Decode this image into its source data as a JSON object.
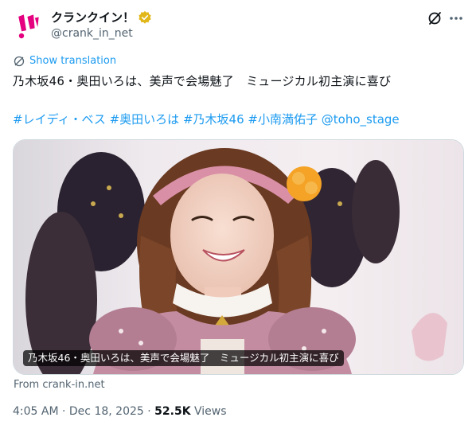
{
  "author": {
    "name": "クランクイン！",
    "handle": "@crank_in_net",
    "verified": true,
    "brand_color": "#e4007f"
  },
  "actions": {
    "grok_icon": "grok-slash-icon",
    "more_icon": "more-dots-icon"
  },
  "translate": {
    "label": "Show translation",
    "icon": "globe-icon"
  },
  "tweet": {
    "text": "乃木坂46・奥田いろは、美声で会場魅了　ミュージカル初主演に喜び",
    "hashtags": [
      "#レイディ・ベス",
      "#奥田いろは",
      "#乃木坂46",
      "#小南満佑子"
    ],
    "mention": "@toho_stage",
    "link_color": "#1d9bf0"
  },
  "card": {
    "caption": "乃木坂46・奥田いろは、美声で会場魅了　ミュージカル初主演に喜び",
    "source": "From crank-in.net"
  },
  "meta": {
    "time": "4:05 AM",
    "date": "Dec 18, 2025",
    "views_count": "52.5K",
    "views_label": "Views",
    "separator": "·"
  }
}
